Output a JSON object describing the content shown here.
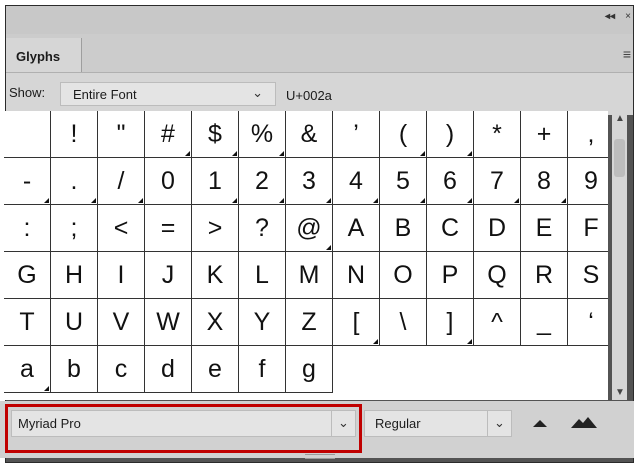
{
  "panel": {
    "collapse_glyph": "◂◂",
    "close_glyph": "×"
  },
  "tabs": [
    {
      "label": "Glyphs"
    }
  ],
  "menu_icon": "menu-icon",
  "show": {
    "label": "Show:",
    "value": "Entire Font",
    "unicode": "U+002a"
  },
  "glyphs": [
    "",
    "!",
    "\"",
    "#",
    "$",
    "%",
    "&",
    "’",
    "(",
    ")",
    "*",
    "+",
    ",",
    "-",
    ".",
    "/",
    "0",
    "1",
    "2",
    "3",
    "4",
    "5",
    "6",
    "7",
    "8",
    "9",
    ":",
    ";",
    "<",
    "=",
    ">",
    "?",
    "@",
    "A",
    "B",
    "C",
    "D",
    "E",
    "F",
    "G",
    "H",
    "I",
    "J",
    "K",
    "L",
    "M",
    "N",
    "O",
    "P",
    "Q",
    "R",
    "S",
    "T",
    "U",
    "V",
    "W",
    "X",
    "Y",
    "Z",
    "[",
    "\\",
    "]",
    "^",
    "_",
    "‘",
    "a",
    "b",
    "c",
    "d",
    "e",
    "f",
    "g"
  ],
  "alternates": [
    false,
    false,
    false,
    true,
    true,
    true,
    false,
    false,
    true,
    true,
    false,
    false,
    true,
    true,
    true,
    true,
    false,
    true,
    true,
    true,
    true,
    true,
    true,
    true,
    true,
    true,
    false,
    false,
    false,
    false,
    false,
    false,
    true,
    false,
    false,
    false,
    false,
    false,
    false,
    false,
    false,
    false,
    false,
    false,
    false,
    false,
    false,
    false,
    false,
    false,
    false,
    false,
    false,
    false,
    false,
    false,
    false,
    false,
    false,
    true,
    false,
    true,
    false,
    false,
    false,
    true,
    false,
    false,
    false,
    false,
    false,
    false
  ],
  "font": {
    "family": "Myriad Pro",
    "style": "Regular",
    "highlight_color": "#c00000"
  },
  "icons": {
    "small": "mountain-small-icon",
    "large": "mountain-large-icon"
  }
}
